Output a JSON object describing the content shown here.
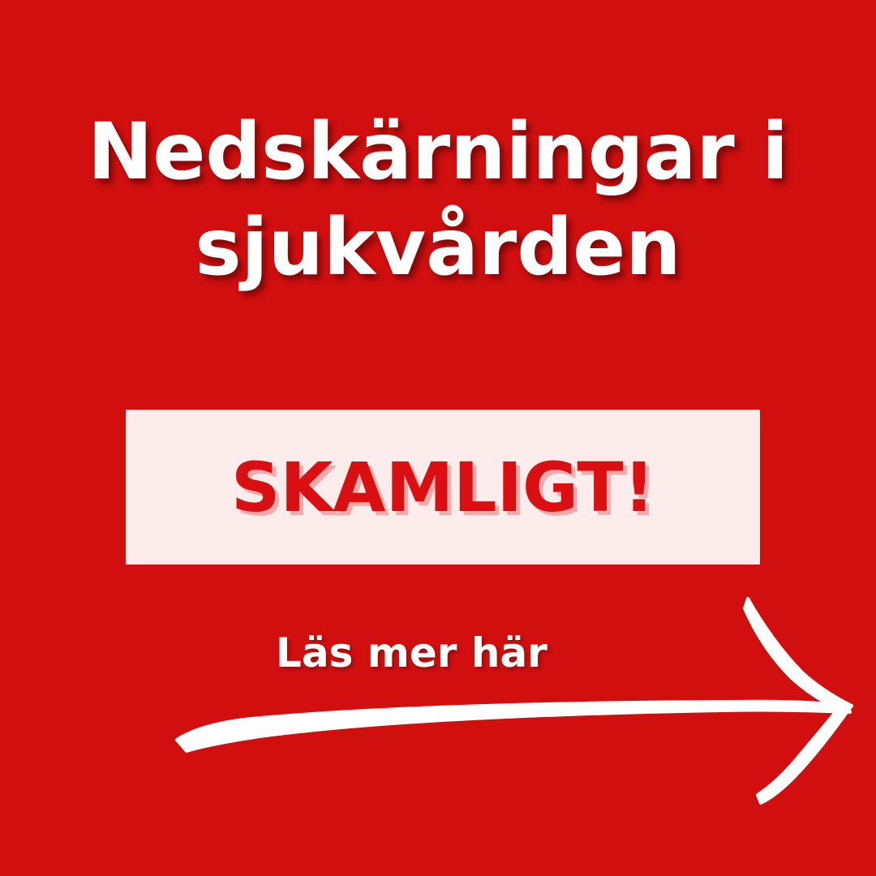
{
  "colors": {
    "background": "#d20f0f",
    "box": "#fcecec",
    "accent_text": "#d90f12",
    "text": "#ffffff"
  },
  "headline": {
    "line1": "Nedskärningar i",
    "line2": "sjukvården"
  },
  "verdict": {
    "label": "SKAMLIGT!"
  },
  "cta": {
    "label": "Läs mer här",
    "icon": "arrow-right-icon"
  }
}
